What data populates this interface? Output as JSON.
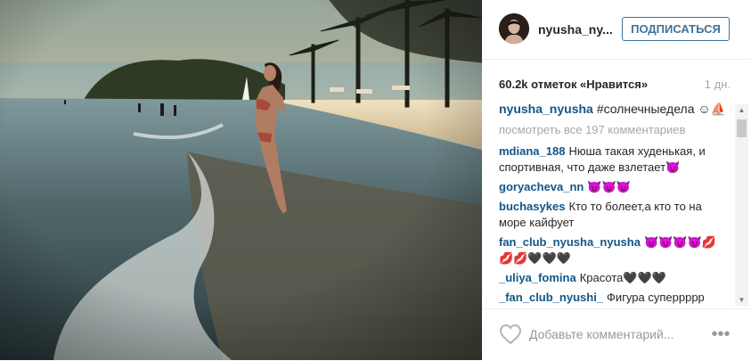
{
  "header": {
    "username": "nyusha_ny...",
    "follow_label": "ПОДПИСАТЬСЯ"
  },
  "post": {
    "likes_text": "60.2k отметок «Нравится»",
    "time_ago": "1 дн."
  },
  "caption": {
    "username": "nyusha_nyusha",
    "text": "#солнечныедела ☺⛵"
  },
  "view_all_comments": "посмотреть все 197 комментариев",
  "comments": [
    {
      "username": "mdiana_188",
      "text": "Нюша такая худенькая, и спортивная, что даже взлетает😈"
    },
    {
      "username": "goryacheva_nn",
      "text": "😈😈😈"
    },
    {
      "username": "buchasykes",
      "text": "Кто то болеет,а кто то на море кайфует"
    },
    {
      "username": "fan_club_nyusha_nyusha",
      "text": "😈😈😈😈💋💋💋🖤🖤🖤"
    },
    {
      "username": "_uliya_fomina",
      "text": "Красота🖤🖤🖤"
    },
    {
      "username": "_fan_club_nyushi_",
      "text": "Фигура суперрррр"
    }
  ],
  "comment_input": {
    "placeholder": "Добавьте комментарий..."
  },
  "icons": {
    "like": "heart-icon",
    "more": "more-options-icon",
    "scroll_up": "scroll-up-arrow-icon",
    "scroll_down": "scroll-down-arrow-icon"
  },
  "colors": {
    "username_link": "#125688",
    "follow_button": "#3f729b",
    "muted_text": "#a5a7aa"
  }
}
